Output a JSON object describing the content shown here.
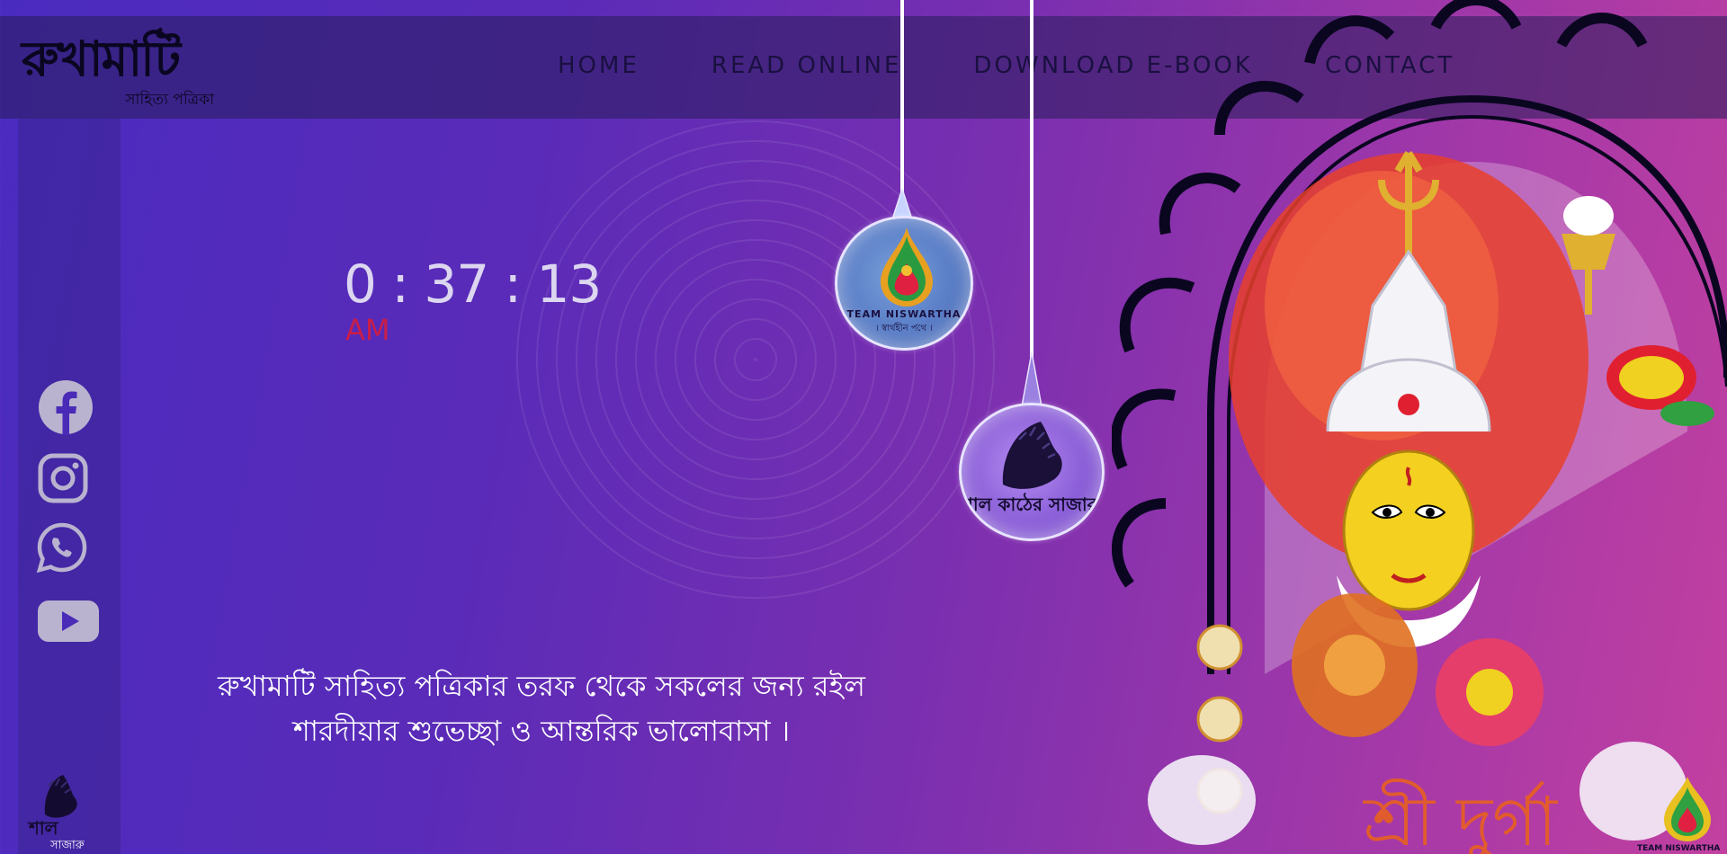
{
  "brand": {
    "logo_main": "রুখামাটি",
    "logo_sub": "সাহিত্য পত্রিকা"
  },
  "nav": {
    "items": [
      {
        "label": "HOME"
      },
      {
        "label": "READ ONLINE"
      },
      {
        "label": "DOWNLOAD E-BOOK"
      },
      {
        "label": "CONTACT"
      }
    ]
  },
  "social": [
    {
      "name": "facebook-icon"
    },
    {
      "name": "instagram-icon"
    },
    {
      "name": "whatsapp-icon"
    },
    {
      "name": "youtube-icon"
    }
  ],
  "clock": {
    "time": "0 : 37 : 13",
    "ampm": "AM"
  },
  "greeting": {
    "line1": "রুখামাটি সাহিত্য পত্রিকার তরফ থেকে সকলের জন্য রইল",
    "line2": "শারদীয়ার শুভেচ্ছা ও আন্তরিক ভালোবাসা ।"
  },
  "ornaments": {
    "team_label": "TEAM NISWARTHA",
    "team_sub": "। স্বার্থহীন পথে ।",
    "shal_label": "শাল কাঠের সাজারু"
  },
  "art": {
    "bottom_text": "শ্রী দুর্গা"
  },
  "colors": {
    "accent_red": "#c81e4a",
    "nav_text": "#1a1040",
    "bg_start": "#4a2bc0",
    "bg_end": "#c240a0"
  }
}
